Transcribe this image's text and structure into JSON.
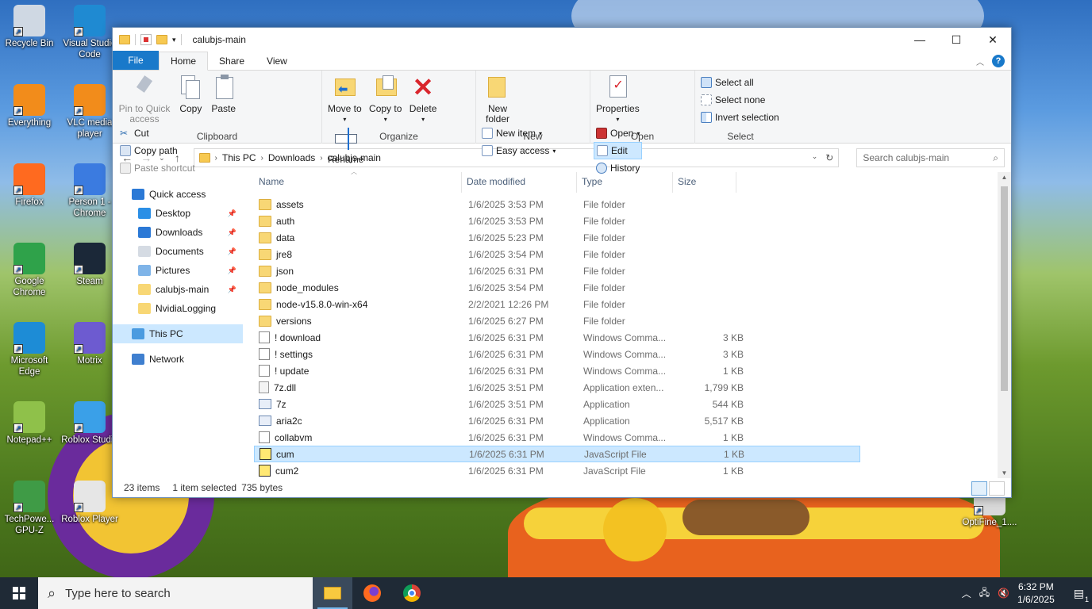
{
  "desktop": {
    "icons_left": [
      {
        "label": "Recycle Bin",
        "color": "#cfd8e3"
      },
      {
        "label": "Everything",
        "color": "#f28c1b"
      },
      {
        "label": "Firefox",
        "color": "#ff6a1f"
      },
      {
        "label": "Google Chrome",
        "color": "#2fa24a"
      },
      {
        "label": "Microsoft Edge",
        "color": "#1d8cd6"
      },
      {
        "label": "Notepad++",
        "color": "#8fc14a"
      },
      {
        "label": "TechPowe... GPU-Z",
        "color": "#3f9b46"
      }
    ],
    "icons_right_col": [
      {
        "label": "Visual Studio Code",
        "color": "#1f8ad2"
      },
      {
        "label": "VLC media player",
        "color": "#f28c1b"
      },
      {
        "label": "Person 1 - Chrome",
        "color": "#3b7be0"
      },
      {
        "label": "Steam",
        "color": "#1b2838"
      },
      {
        "label": "Motrix",
        "color": "#6d5bd0"
      },
      {
        "label": "Roblox Studio",
        "color": "#3aa0e8"
      },
      {
        "label": "Roblox Player",
        "color": "#e6e6e6"
      }
    ],
    "icon_far_right": {
      "label": "OptiFine_1....",
      "color": "#d9d9d9"
    }
  },
  "window": {
    "title": "calubjs-main",
    "controls": {
      "minimize": "—",
      "maximize": "☐",
      "close": "✕"
    },
    "tabs": [
      "File",
      "Home",
      "Share",
      "View"
    ],
    "ribbon": {
      "clipboard": {
        "label": "Clipboard",
        "pin": "Pin to Quick access",
        "copy": "Copy",
        "paste": "Paste",
        "cut": "Cut",
        "copy_path": "Copy path",
        "paste_shortcut": "Paste shortcut"
      },
      "organize": {
        "label": "Organize",
        "move_to": "Move to",
        "copy_to": "Copy to",
        "delete": "Delete",
        "rename": "Rename"
      },
      "new": {
        "label": "New",
        "new_folder": "New folder",
        "new_item": "New item",
        "easy_access": "Easy access"
      },
      "open": {
        "label": "Open",
        "properties": "Properties",
        "open": "Open",
        "edit": "Edit",
        "history": "History"
      },
      "select": {
        "label": "Select",
        "select_all": "Select all",
        "select_none": "Select none",
        "invert": "Invert selection"
      }
    },
    "address": {
      "crumbs": [
        "This PC",
        "Downloads",
        "calubjs-main"
      ]
    },
    "search_placeholder": "Search calubjs-main",
    "nav_pane": [
      {
        "label": "Quick access",
        "kind": "top",
        "color": "#2b79d6"
      },
      {
        "label": "Desktop",
        "kind": "sub",
        "color": "#2b8fe6",
        "pinned": true
      },
      {
        "label": "Downloads",
        "kind": "sub",
        "color": "#2b79d6",
        "pinned": true
      },
      {
        "label": "Documents",
        "kind": "sub",
        "color": "#d5dbe3",
        "pinned": true
      },
      {
        "label": "Pictures",
        "kind": "sub",
        "color": "#7fb4e8",
        "pinned": true
      },
      {
        "label": "calubjs-main",
        "kind": "sub",
        "color": "#f8d775",
        "pinned": true
      },
      {
        "label": "NvidiaLogging",
        "kind": "sub",
        "color": "#f8d775",
        "pinned": false
      },
      {
        "label": "This PC",
        "kind": "top",
        "color": "#4a9be0",
        "selected": true
      },
      {
        "label": "Network",
        "kind": "top",
        "color": "#3f7fcf"
      }
    ],
    "columns": [
      "Name",
      "Date modified",
      "Type",
      "Size"
    ],
    "files": [
      {
        "name": "assets",
        "date": "1/6/2025 3:53 PM",
        "type": "File folder",
        "size": "",
        "icon": "folder"
      },
      {
        "name": "auth",
        "date": "1/6/2025 3:53 PM",
        "type": "File folder",
        "size": "",
        "icon": "folder"
      },
      {
        "name": "data",
        "date": "1/6/2025 5:23 PM",
        "type": "File folder",
        "size": "",
        "icon": "folder"
      },
      {
        "name": "jre8",
        "date": "1/6/2025 3:54 PM",
        "type": "File folder",
        "size": "",
        "icon": "folder"
      },
      {
        "name": "json",
        "date": "1/6/2025 6:31 PM",
        "type": "File folder",
        "size": "",
        "icon": "folder"
      },
      {
        "name": "node_modules",
        "date": "1/6/2025 3:54 PM",
        "type": "File folder",
        "size": "",
        "icon": "folder"
      },
      {
        "name": "node-v15.8.0-win-x64",
        "date": "2/2/2021 12:26 PM",
        "type": "File folder",
        "size": "",
        "icon": "folder"
      },
      {
        "name": "versions",
        "date": "1/6/2025 6:27 PM",
        "type": "File folder",
        "size": "",
        "icon": "folder"
      },
      {
        "name": "! download",
        "date": "1/6/2025 6:31 PM",
        "type": "Windows Comma...",
        "size": "3 KB",
        "icon": "cmd"
      },
      {
        "name": "! settings",
        "date": "1/6/2025 6:31 PM",
        "type": "Windows Comma...",
        "size": "3 KB",
        "icon": "cmd"
      },
      {
        "name": "! update",
        "date": "1/6/2025 6:31 PM",
        "type": "Windows Comma...",
        "size": "1 KB",
        "icon": "cmd"
      },
      {
        "name": "7z.dll",
        "date": "1/6/2025 3:51 PM",
        "type": "Application exten...",
        "size": "1,799 KB",
        "icon": "dll"
      },
      {
        "name": "7z",
        "date": "1/6/2025 3:51 PM",
        "type": "Application",
        "size": "544 KB",
        "icon": "app"
      },
      {
        "name": "aria2c",
        "date": "1/6/2025 6:31 PM",
        "type": "Application",
        "size": "5,517 KB",
        "icon": "app"
      },
      {
        "name": "collabvm",
        "date": "1/6/2025 6:31 PM",
        "type": "Windows Comma...",
        "size": "1 KB",
        "icon": "cmd"
      },
      {
        "name": "cum",
        "date": "1/6/2025 6:31 PM",
        "type": "JavaScript File",
        "size": "1 KB",
        "icon": "js",
        "selected": true
      },
      {
        "name": "cum2",
        "date": "1/6/2025 6:31 PM",
        "type": "JavaScript File",
        "size": "1 KB",
        "icon": "js"
      }
    ],
    "status": {
      "count": "23 items",
      "selection": "1 item selected",
      "bytes": "735 bytes"
    }
  },
  "taskbar": {
    "search_placeholder": "Type here to search",
    "time": "6:32 PM",
    "date": "1/6/2025",
    "notif_count": "1"
  }
}
